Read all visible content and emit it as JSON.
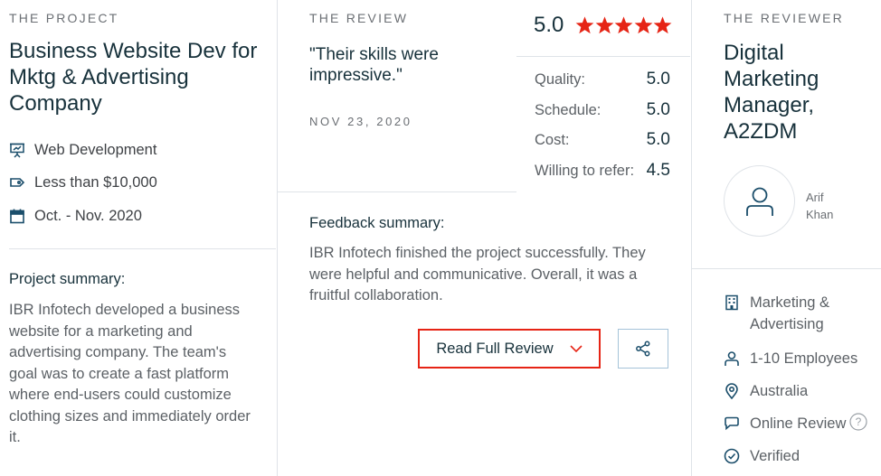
{
  "project": {
    "eyebrow": "THE PROJECT",
    "title": "Business Website Dev for Mktg & Advertising Company",
    "service": "Web Development",
    "budget": "Less than $10,000",
    "timeline": "Oct. - Nov. 2020",
    "summary_label": "Project summary:",
    "summary_text": "IBR Infotech developed a business website for a marketing and advertising company. The team's goal was to create a fast platform where end-users could customize clothing sizes and immediately order it."
  },
  "review": {
    "eyebrow": "THE REVIEW",
    "quote": "\"Their skills were impressive.\"",
    "date": "NOV 23, 2020",
    "overall_score": "5.0",
    "stars_filled": 5,
    "ratings": [
      {
        "label": "Quality:",
        "value": "5.0"
      },
      {
        "label": "Schedule:",
        "value": "5.0"
      },
      {
        "label": "Cost:",
        "value": "5.0"
      },
      {
        "label": "Willing to refer:",
        "value": "4.5"
      }
    ],
    "feedback_label": "Feedback summary:",
    "feedback_text": "IBR Infotech finished the project successfully. They were helpful and communicative. Overall, it was a fruitful collaboration.",
    "read_full_label": "Read Full Review"
  },
  "reviewer": {
    "eyebrow": "THE REVIEWER",
    "title": "Digital Marketing Manager, A2ZDM",
    "first_name": "Arif",
    "last_name": "Khan",
    "industry": "Marketing & Advertising",
    "size": "1-10 Employees",
    "location": "Australia",
    "review_type": "Online Review",
    "verification": "Verified"
  },
  "colors": {
    "accent_red": "#e62415",
    "star_red": "#e62415",
    "heading": "#17313b",
    "icon_blue": "#1b4e6b"
  },
  "icons": {
    "service": "presentation-icon",
    "budget": "price-tag-icon",
    "timeline": "calendar-icon",
    "industry": "building-icon",
    "size": "user-icon",
    "location": "location-pin-icon",
    "review_type": "chat-bubble-icon",
    "verification": "check-circle-icon",
    "share": "share-icon",
    "dropdown": "chevron-down-icon",
    "help": "question-icon"
  }
}
